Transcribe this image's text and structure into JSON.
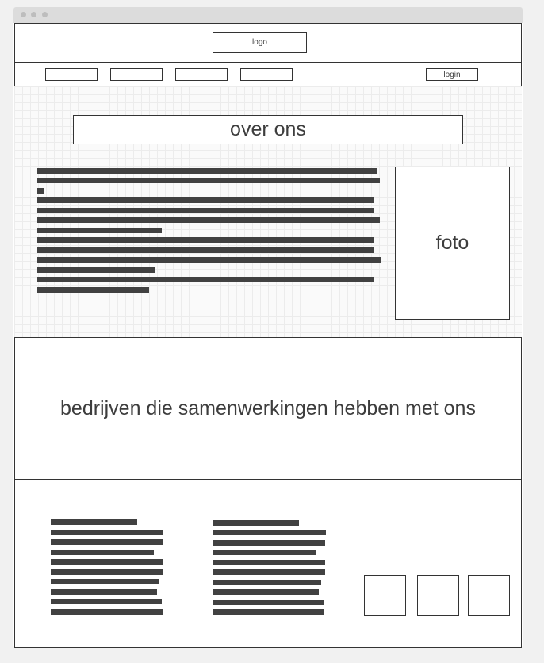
{
  "header": {
    "logo_label": "logo"
  },
  "nav": {
    "login_label": "login",
    "nav_items": [
      "",
      "",
      "",
      ""
    ]
  },
  "hero": {
    "title": "over ons",
    "photo_label": "foto"
  },
  "partners": {
    "heading": "bedrijven die samenwerkingen hebben met ons"
  },
  "colors": {
    "page_bg": "#f1f1f1",
    "ink": "#333333",
    "text_bar": "#414141",
    "grid_line": "#ececec"
  }
}
